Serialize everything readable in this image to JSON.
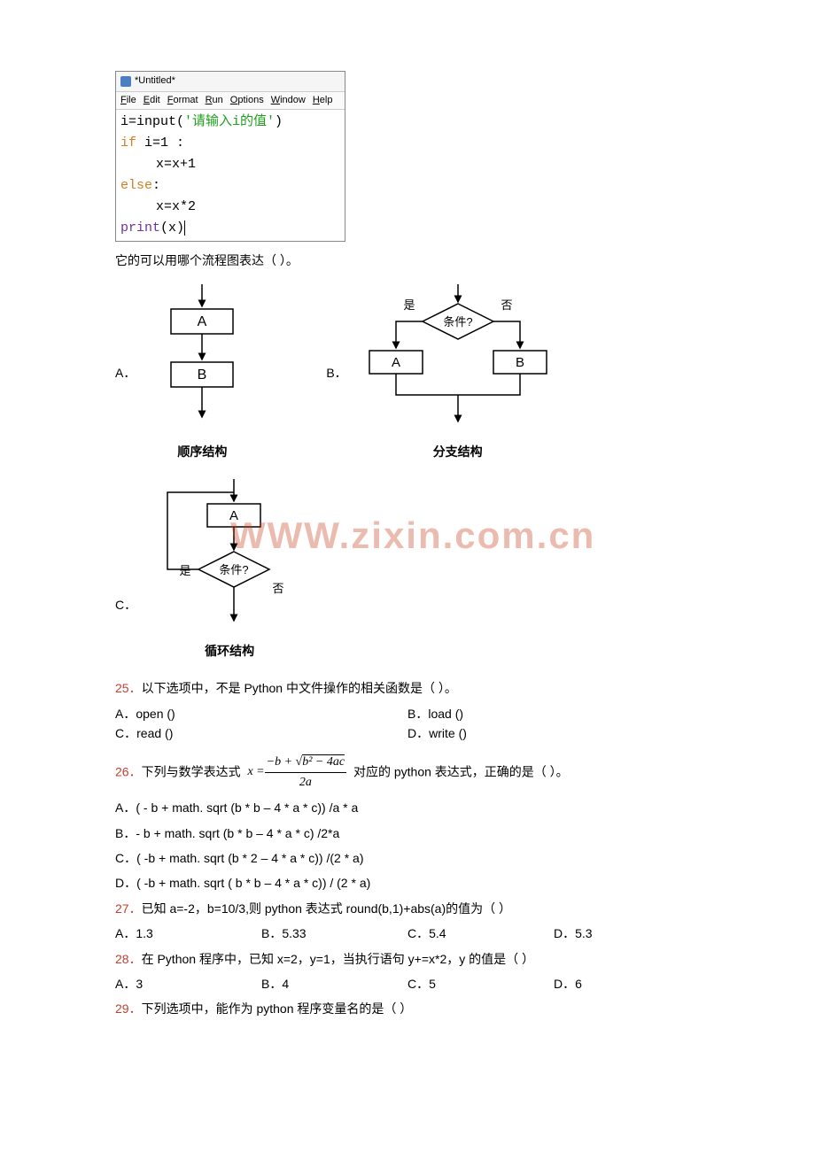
{
  "editor": {
    "title": "*Untitled*",
    "menu": [
      "File",
      "Edit",
      "Format",
      "Run",
      "Options",
      "Window",
      "Help"
    ],
    "code": {
      "l1_fn": "i=input",
      "l1_paren_open": "(",
      "l1_str": "'请输入i的值'",
      "l1_paren_close": ")",
      "l2_kw": "if",
      "l2_rest": " i=1 :",
      "l3": "x=x+1",
      "l4_kw": "else",
      "l4_colon": ":",
      "l5": "x=x*2",
      "l6_fn": "print",
      "l6_arg": "(x)"
    }
  },
  "q24_tail": "它的可以用哪个流程图表达（  ）。",
  "diagramA": {
    "boxA": "A",
    "boxB": "B",
    "caption": "顺序结构"
  },
  "diagramB": {
    "yes": "是",
    "no": "否",
    "cond": "条件?",
    "boxA": "A",
    "boxB": "B",
    "caption": "分支结构"
  },
  "diagramC": {
    "boxA": "A",
    "cond": "条件?",
    "yes": "是",
    "no": "否",
    "caption": "循环结构"
  },
  "optLabels": {
    "A": "A．",
    "B": "B．",
    "C": "C．",
    "D": "D．"
  },
  "watermark": "WWW.zixin.com.cn",
  "q25": {
    "num": "25．",
    "text": "以下选项中，不是 Python 中文件操作的相关函数是（  ）。",
    "A": "open ()",
    "B": "load ()",
    "C": "read ()",
    "D": "write ()"
  },
  "q26": {
    "num": "26．",
    "text_before": "下列与数学表达式",
    "x_eq": "x = ",
    "frac_top": "−b + √(b² − 4ac)",
    "frac_top_plain_left": "−b + ",
    "frac_top_sqrt": "b² − 4ac",
    "frac_bot": "2a",
    "text_after": " 对应的 python 表达式，正确的是（  ）。",
    "A": "( - b + math. sqrt (b * b – 4 * a * c)) /a * a",
    "B": "- b + math. sqrt (b * b – 4 * a * c) /2*a",
    "C": "( -b + math. sqrt (b * 2 – 4 * a * c)) /(2 * a)",
    "D": "( -b + math. sqrt ( b * b – 4 * a * c)) / (2 * a)"
  },
  "q27": {
    "num": "27．",
    "text": "已知 a=-2，b=10/3,则 python 表达式 round(b,1)+abs(a)的值为（  ）",
    "A": "1.3",
    "B": "5.33",
    "C": "5.4",
    "D": "5.3"
  },
  "q28": {
    "num": "28．",
    "text": "在 Python 程序中，已知 x=2，y=1，当执行语句 y+=x*2，y 的值是（  ）",
    "A": "3",
    "B": "4",
    "C": "5",
    "D": "6"
  },
  "q29": {
    "num": "29．",
    "text": "下列选项中，能作为 python 程序变量名的是（  ）"
  }
}
